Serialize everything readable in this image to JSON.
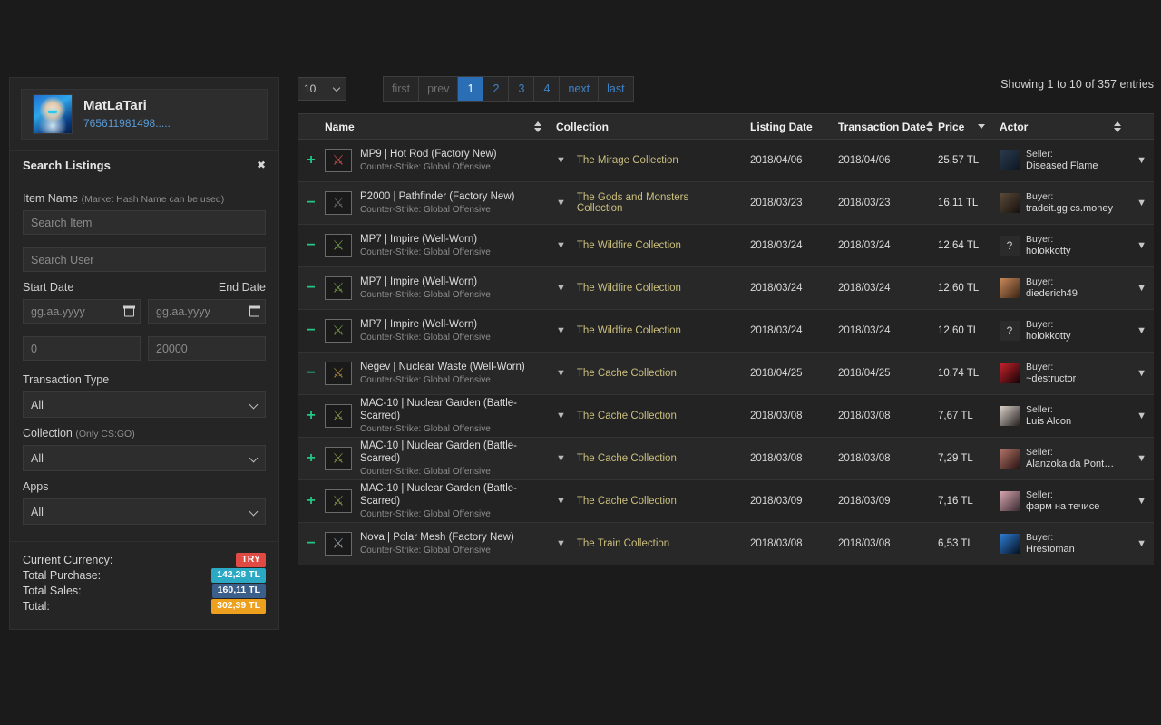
{
  "sidebar": {
    "profile": {
      "username": "MatLaTari",
      "steam_id": "765611981498....."
    },
    "search_panel": {
      "title": "Search Listings",
      "close_icon": "✖",
      "item_name_label": "Item Name",
      "item_name_hint": "(Market Hash Name can be used)",
      "item_placeholder": "Search Item",
      "user_placeholder": "Search User",
      "start_date_label": "Start Date",
      "end_date_label": "End Date",
      "date_placeholder": "gg.aa.yyyy",
      "price_min_placeholder": "0",
      "price_max_placeholder": "20000",
      "transaction_type_label": "Transaction Type",
      "transaction_type_value": "All",
      "collection_label": "Collection",
      "collection_hint": "(Only CS:GO)",
      "collection_value": "All",
      "apps_label": "Apps",
      "apps_value": "All"
    },
    "totals": {
      "currency_label": "Current Currency:",
      "currency_value": "TRY",
      "currency_color": "#e04a43",
      "purchase_label": "Total Purchase:",
      "purchase_value": "142,28 TL",
      "purchase_color": "#2aa8c4",
      "sales_label": "Total Sales:",
      "sales_value": "160,11 TL",
      "sales_color": "#3a5f8a",
      "total_label": "Total:",
      "total_value": "302,39 TL",
      "total_color": "#eda01e"
    }
  },
  "main": {
    "toolbar": {
      "page_length": "10",
      "entries_info": "Showing 1 to 10 of 357 entries",
      "pagination": [
        {
          "label": "first",
          "state": "disabled"
        },
        {
          "label": "prev",
          "state": "disabled"
        },
        {
          "label": "1",
          "state": "active"
        },
        {
          "label": "2",
          "state": "normal"
        },
        {
          "label": "3",
          "state": "normal"
        },
        {
          "label": "4",
          "state": "normal"
        },
        {
          "label": "next",
          "state": "normal"
        },
        {
          "label": "last",
          "state": "normal"
        }
      ]
    },
    "table": {
      "columns": [
        {
          "label": "Name",
          "sort": "both"
        },
        {
          "label": "Collection",
          "sort": "none"
        },
        {
          "label": "Listing Date",
          "sort": "none"
        },
        {
          "label": "Transaction Date",
          "sort": "both"
        },
        {
          "label": "Price",
          "sort": "desc"
        },
        {
          "label": "Actor",
          "sort": "both"
        }
      ],
      "filter_icon": "▼",
      "rows": [
        {
          "sign": "+",
          "icon": "mp9-hot-rod-icon",
          "gun": "🔫",
          "gun_color": "#d4534f",
          "name": "MP9 | Hot Rod (Factory New)",
          "game": "Counter-Strike: Global Offensive",
          "collection": "The Mirage Collection",
          "listing_date": "2018/04/06",
          "transaction_date": "2018/04/06",
          "price": "25,57 TL",
          "actor_role": "Seller:",
          "actor_name": "Diseased Flame",
          "avatar_type": "image",
          "avatar_color": "#2a3b4e",
          "avatar_color2": "#0d1722"
        },
        {
          "sign": "−",
          "icon": "p2000-pathfinder-icon",
          "gun": "🔫",
          "gun_color": "#6b6b6b",
          "name": "P2000 | Pathfinder (Factory New)",
          "game": "Counter-Strike: Global Offensive",
          "collection": "The Gods and Monsters Collection",
          "listing_date": "2018/03/23",
          "transaction_date": "2018/03/23",
          "price": "16,11 TL",
          "actor_role": "Buyer:",
          "actor_name": "tradeit.gg cs.money",
          "avatar_type": "image",
          "avatar_color": "#5c4b3a",
          "avatar_color2": "#16110c"
        },
        {
          "sign": "−",
          "icon": "mp7-impire-icon",
          "gun": "🔫",
          "gun_color": "#76a04a",
          "name": "MP7 | Impire (Well-Worn)",
          "game": "Counter-Strike: Global Offensive",
          "collection": "The Wildfire Collection",
          "listing_date": "2018/03/24",
          "transaction_date": "2018/03/24",
          "price": "12,64 TL",
          "actor_role": "Buyer:",
          "actor_name": "holokkotty",
          "avatar_type": "unknown",
          "avatar_color": "#2b2b2b",
          "avatar_color2": "#2b2b2b"
        },
        {
          "sign": "−",
          "icon": "mp7-impire-icon",
          "gun": "🔫",
          "gun_color": "#76a04a",
          "name": "MP7 | Impire (Well-Worn)",
          "game": "Counter-Strike: Global Offensive",
          "collection": "The Wildfire Collection",
          "listing_date": "2018/03/24",
          "transaction_date": "2018/03/24",
          "price": "12,60 TL",
          "actor_role": "Buyer:",
          "actor_name": "diederich49",
          "avatar_type": "image",
          "avatar_color": "#c98a5a",
          "avatar_color2": "#3a2414"
        },
        {
          "sign": "−",
          "icon": "mp7-impire-icon",
          "gun": "🔫",
          "gun_color": "#76a04a",
          "name": "MP7 | Impire (Well-Worn)",
          "game": "Counter-Strike: Global Offensive",
          "collection": "The Wildfire Collection",
          "listing_date": "2018/03/24",
          "transaction_date": "2018/03/24",
          "price": "12,60 TL",
          "actor_role": "Buyer:",
          "actor_name": "holokkotty",
          "avatar_type": "unknown",
          "avatar_color": "#2b2b2b",
          "avatar_color2": "#2b2b2b"
        },
        {
          "sign": "−",
          "icon": "negev-nuclear-waste-icon",
          "gun": "🔫",
          "gun_color": "#b08a42",
          "name": "Negev | Nuclear Waste (Well-Worn)",
          "game": "Counter-Strike: Global Offensive",
          "collection": "The Cache Collection",
          "listing_date": "2018/04/25",
          "transaction_date": "2018/04/25",
          "price": "10,74 TL",
          "actor_role": "Buyer:",
          "actor_name": "~destructor",
          "avatar_type": "image",
          "avatar_color": "#c8232c",
          "avatar_color2": "#120305"
        },
        {
          "sign": "+",
          "icon": "mac10-nuclear-garden-icon",
          "gun": "🔫",
          "gun_color": "#8a9a4a",
          "name": "MAC-10 | Nuclear Garden (Battle-Scarred)",
          "game": "Counter-Strike: Global Offensive",
          "collection": "The Cache Collection",
          "listing_date": "2018/03/08",
          "transaction_date": "2018/03/08",
          "price": "7,67 TL",
          "actor_role": "Seller:",
          "actor_name": "Luis Alcon",
          "avatar_type": "image",
          "avatar_color": "#dcd3cb",
          "avatar_color2": "#262220"
        },
        {
          "sign": "+",
          "icon": "mac10-nuclear-garden-icon",
          "gun": "🔫",
          "gun_color": "#8a9a4a",
          "name": "MAC-10 | Nuclear Garden (Battle-Scarred)",
          "game": "Counter-Strike: Global Offensive",
          "collection": "The Cache Collection",
          "listing_date": "2018/03/08",
          "transaction_date": "2018/03/08",
          "price": "7,29 TL",
          "actor_role": "Seller:",
          "actor_name": "Alanzoka da Ponta d...",
          "avatar_type": "image",
          "avatar_color": "#b4756a",
          "avatar_color2": "#2a1412"
        },
        {
          "sign": "+",
          "icon": "mac10-nuclear-garden-icon",
          "gun": "🔫",
          "gun_color": "#8a9a4a",
          "name": "MAC-10 | Nuclear Garden (Battle-Scarred)",
          "game": "Counter-Strike: Global Offensive",
          "collection": "The Cache Collection",
          "listing_date": "2018/03/09",
          "transaction_date": "2018/03/09",
          "price": "7,16 TL",
          "actor_role": "Seller:",
          "actor_name": "фарм на течисе",
          "avatar_type": "image",
          "avatar_color": "#d8a7b0",
          "avatar_color2": "#3a2a33"
        },
        {
          "sign": "−",
          "icon": "nova-polar-mesh-icon",
          "gun": "🔫",
          "gun_color": "#9aa3ab",
          "name": "Nova | Polar Mesh (Factory New)",
          "game": "Counter-Strike: Global Offensive",
          "collection": "The Train Collection",
          "listing_date": "2018/03/08",
          "transaction_date": "2018/03/08",
          "price": "6,53 TL",
          "actor_role": "Buyer:",
          "actor_name": "Hrestoman",
          "avatar_type": "image",
          "avatar_color": "#2f7fd8",
          "avatar_color2": "#04101f"
        }
      ]
    }
  }
}
